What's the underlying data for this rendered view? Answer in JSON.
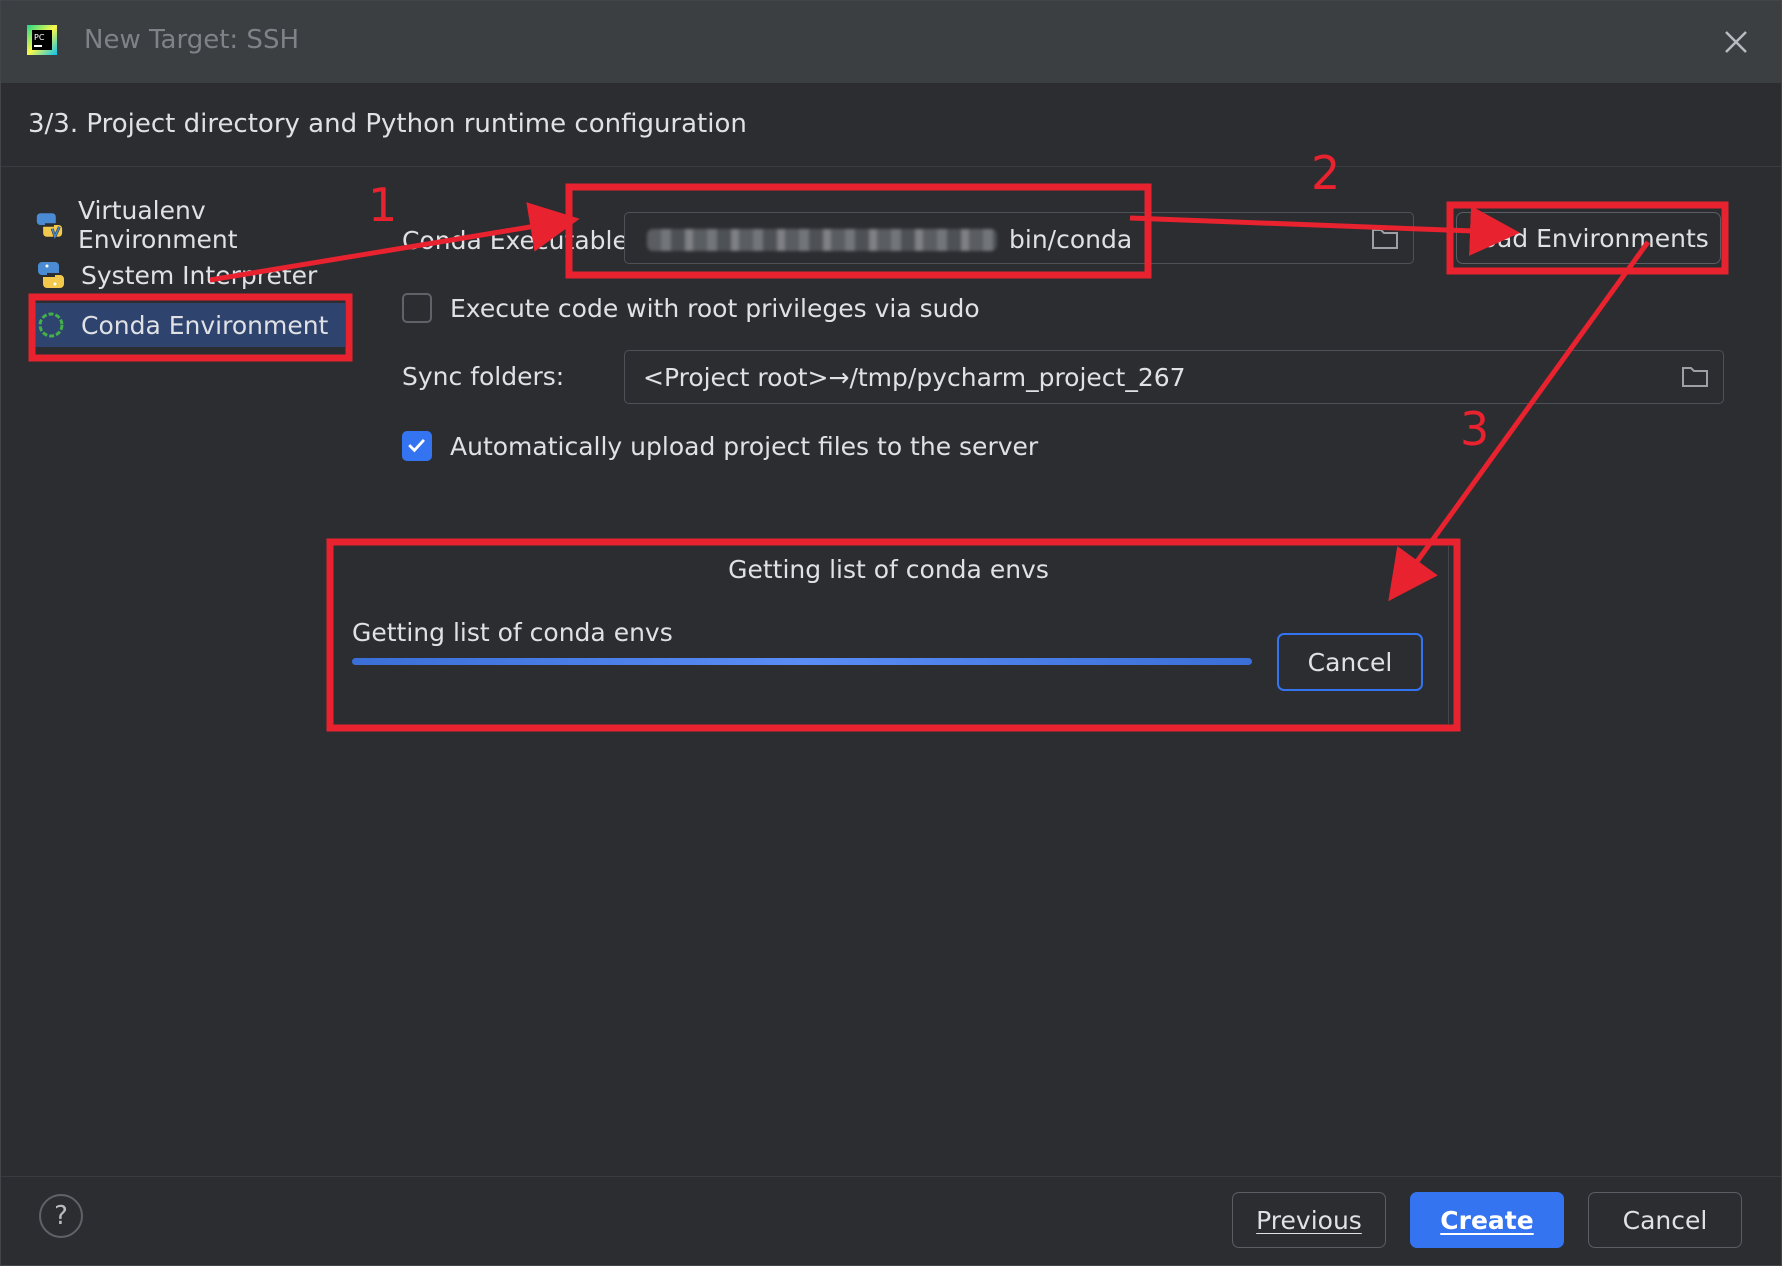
{
  "window": {
    "title": "New Target: SSH",
    "app_icon": "pycharm-icon"
  },
  "header": {
    "step": "3/3. Project directory and Python runtime configuration"
  },
  "sidebar": {
    "items": [
      {
        "label": "Virtualenv Environment",
        "icon": "virtualenv-icon",
        "selected": false
      },
      {
        "label": "System Interpreter",
        "icon": "python-icon",
        "selected": false
      },
      {
        "label": "Conda Environment",
        "icon": "conda-icon",
        "selected": true
      }
    ]
  },
  "form": {
    "conda_label": "Conda Executable:",
    "conda_value": "bin/conda",
    "load_button": "Load Environments",
    "sudo_label": "Execute code with root privileges via sudo",
    "sudo_checked": false,
    "sync_label": "Sync folders:",
    "sync_value": "<Project root>→/tmp/pycharm_project_267",
    "upload_label": "Automatically upload project files to the server",
    "upload_checked": true
  },
  "progress": {
    "title": "Getting list of conda envs",
    "label": "Getting list of conda envs",
    "cancel": "Cancel",
    "fraction": 1.0
  },
  "footer": {
    "help": "?",
    "previous": "Previous",
    "create": "Create",
    "cancel": "Cancel"
  },
  "annotations": {
    "n1": "1",
    "n2": "2",
    "n3": "3"
  },
  "colors": {
    "accent": "#3574f0",
    "annotation": "#e8222f",
    "background": "#2b2d30"
  }
}
